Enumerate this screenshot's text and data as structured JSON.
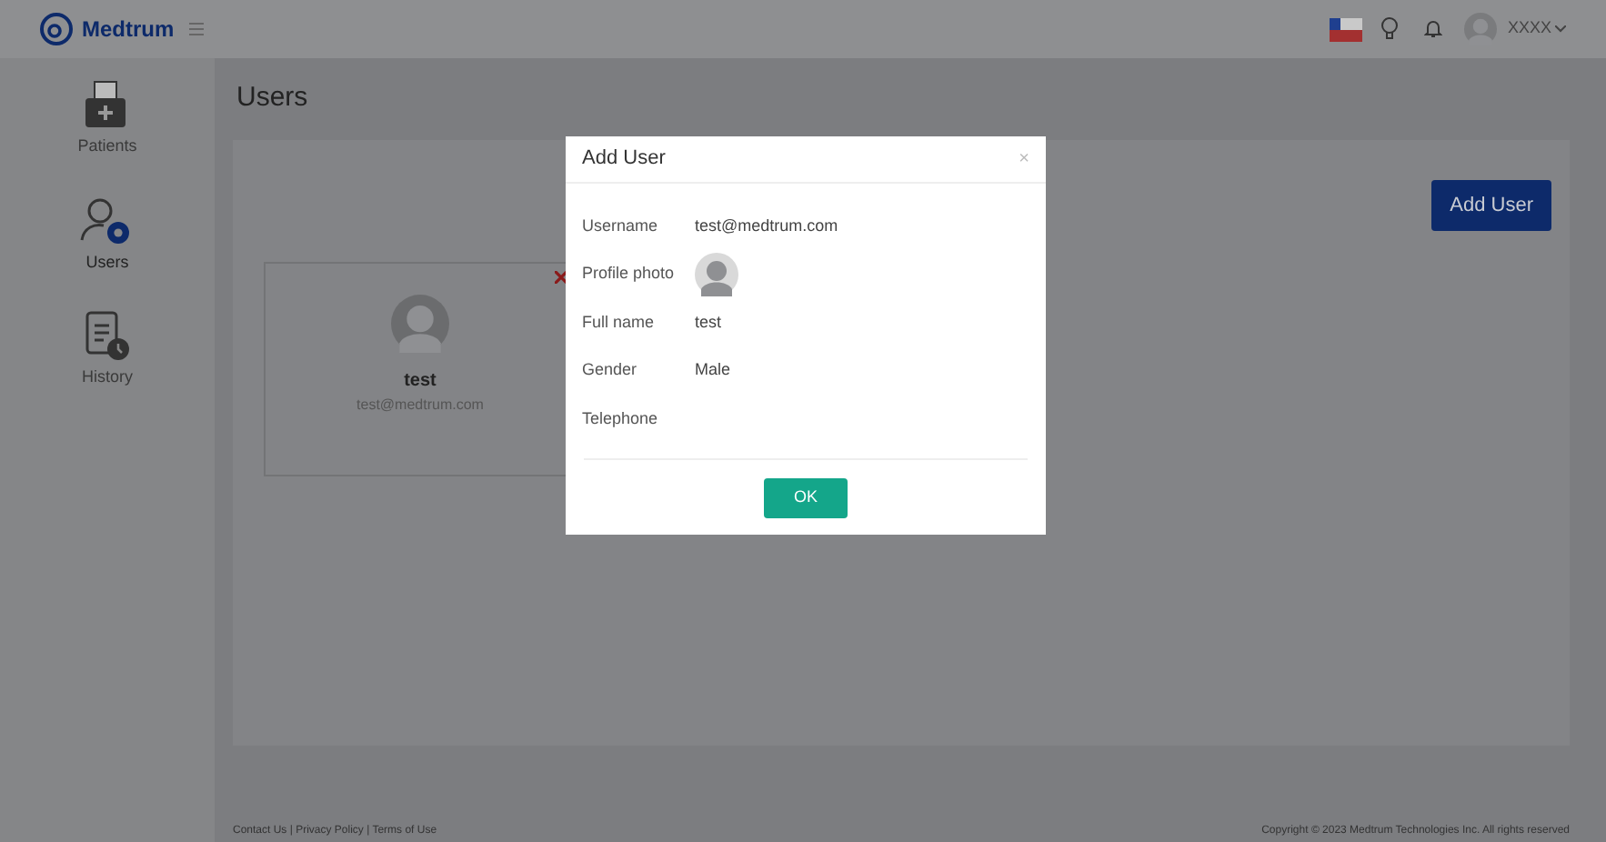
{
  "brand": "Medtrum",
  "topbar": {
    "user": "XXXX"
  },
  "sidebar": {
    "items": [
      {
        "label": "Patients",
        "kind": "patients",
        "selected": false
      },
      {
        "label": "Users",
        "kind": "users",
        "selected": true
      },
      {
        "label": "History",
        "kind": "history",
        "selected": false
      }
    ]
  },
  "page": {
    "title": "Users",
    "add_button": "Add User"
  },
  "user_cards": [
    {
      "name": "test",
      "email": "test@medtrum.com"
    }
  ],
  "dialog": {
    "title": "Add User",
    "close": "×",
    "fields": [
      {
        "label": "Username",
        "kind": "text",
        "value": "test@medtrum.com"
      },
      {
        "label": "Profile photo",
        "kind": "photo"
      },
      {
        "label": "Full name",
        "kind": "text",
        "value": "test"
      },
      {
        "label": "Gender",
        "kind": "text",
        "value": "Male"
      },
      {
        "label": "Telephone",
        "kind": "text"
      }
    ],
    "ok": "OK"
  },
  "footer": {
    "links": "Contact Us | Privacy Policy | Terms of Use",
    "copyright": "Copyright © 2023 Medtrum Technologies Inc. All rights reserved"
  }
}
